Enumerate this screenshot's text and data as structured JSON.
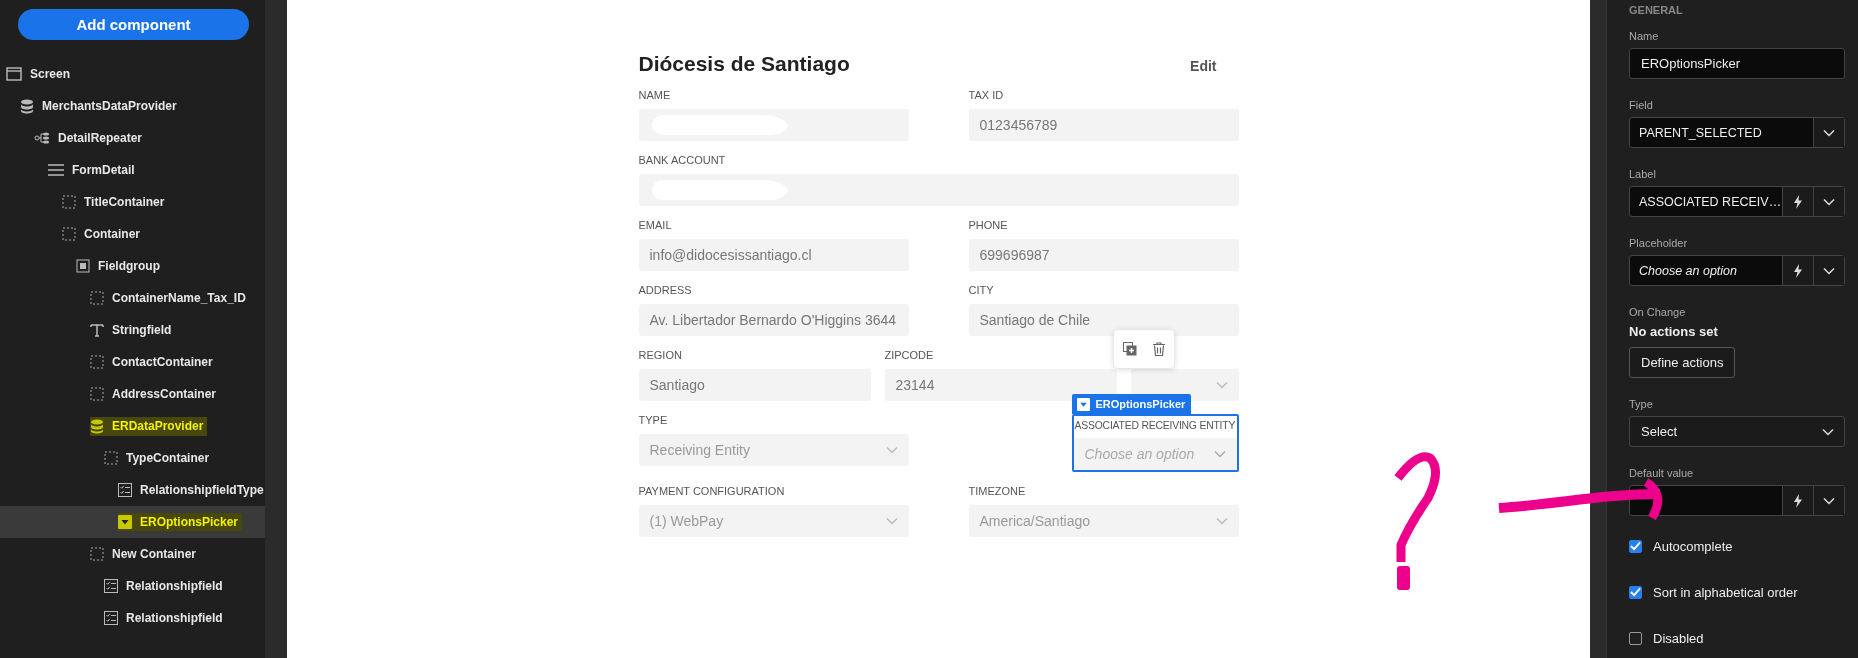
{
  "sidebar": {
    "add_button": "Add component",
    "tree": [
      {
        "label": "Screen",
        "kind": "screen",
        "selected": false,
        "highlighted": false,
        "children": [
          {
            "label": "MerchantsDataProvider",
            "kind": "database",
            "selected": false,
            "highlighted": false,
            "children": [
              {
                "label": "DetailRepeater",
                "kind": "repeater",
                "selected": false,
                "highlighted": false,
                "children": [
                  {
                    "label": "FormDetail",
                    "kind": "list",
                    "selected": false,
                    "highlighted": false,
                    "children": [
                      {
                        "label": "TitleContainer",
                        "kind": "container",
                        "selected": false,
                        "highlighted": false
                      },
                      {
                        "label": "Container",
                        "kind": "container",
                        "selected": false,
                        "highlighted": false,
                        "children": [
                          {
                            "label": "Fieldgroup",
                            "kind": "fieldgroup",
                            "selected": false,
                            "highlighted": false,
                            "children": [
                              {
                                "label": "ContainerName_Tax_ID",
                                "kind": "container",
                                "selected": false,
                                "highlighted": false
                              },
                              {
                                "label": "Stringfield",
                                "kind": "text",
                                "selected": false,
                                "highlighted": false
                              },
                              {
                                "label": "ContactContainer",
                                "kind": "container",
                                "selected": false,
                                "highlighted": false
                              },
                              {
                                "label": "AddressContainer",
                                "kind": "container",
                                "selected": false,
                                "highlighted": false
                              },
                              {
                                "label": "ERDataProvider",
                                "kind": "database",
                                "selected": false,
                                "highlighted": true,
                                "children": [
                                  {
                                    "label": "TypeContainer",
                                    "kind": "container",
                                    "selected": false,
                                    "highlighted": false,
                                    "children": [
                                      {
                                        "label": "RelationshipfieldType",
                                        "kind": "checklist",
                                        "selected": false,
                                        "highlighted": false
                                      },
                                      {
                                        "label": "EROptionsPicker",
                                        "kind": "picker",
                                        "selected": true,
                                        "highlighted": true
                                      }
                                    ]
                                  }
                                ]
                              },
                              {
                                "label": "New Container",
                                "kind": "container",
                                "selected": false,
                                "highlighted": false,
                                "children": [
                                  {
                                    "label": "Relationshipfield",
                                    "kind": "checklist",
                                    "selected": false,
                                    "highlighted": false
                                  },
                                  {
                                    "label": "Relationshipfield",
                                    "kind": "checklist",
                                    "selected": false,
                                    "highlighted": false
                                  }
                                ]
                              }
                            ]
                          }
                        ]
                      }
                    ]
                  }
                ]
              }
            ]
          }
        ]
      }
    ]
  },
  "form": {
    "title": "Diócesis de Santiago",
    "edit": "Edit",
    "rows": [
      [
        {
          "label": "NAME",
          "kind": "redacted"
        },
        {
          "label": "TAX ID",
          "kind": "text",
          "value": "0123456789"
        }
      ],
      [
        {
          "label": "BANK ACCOUNT",
          "kind": "redacted"
        }
      ],
      [
        {
          "label": "EMAIL",
          "kind": "text",
          "value": "info@didocesissantiago.cl"
        },
        {
          "label": "PHONE",
          "kind": "text",
          "value": "699696987"
        }
      ],
      [
        {
          "label": "ADDRESS",
          "kind": "text",
          "value": "Av. Libertador Bernardo O'Higgins 3644"
        },
        {
          "label": "CITY",
          "kind": "text",
          "value": "Santiago de Chile"
        }
      ],
      [
        {
          "label": "REGION",
          "kind": "text",
          "value": "Santiago"
        },
        {
          "label": "ZIPCODE",
          "kind": "text",
          "value": "23144"
        },
        {
          "kind": "select"
        }
      ],
      [
        {
          "label": "TYPE",
          "kind": "select",
          "value": "Receiving Entity"
        },
        {
          "label": "ASSOCIATED RECEIVING ENTITY",
          "kind": "picker",
          "placeholder": "Choose an option",
          "selected": true,
          "tag": "EROptionsPicker"
        }
      ],
      [
        {
          "label": "PAYMENT CONFIGURATION",
          "kind": "select",
          "value": "(1) WebPay"
        },
        {
          "label": "TIMEZONE",
          "kind": "select",
          "value": "America/Santiago"
        }
      ]
    ]
  },
  "panel": {
    "section": "GENERAL",
    "items": [
      {
        "kind": "input",
        "label": "Name",
        "value": "EROptionsPicker"
      },
      {
        "kind": "select",
        "label": "Field",
        "value": "PARENT_SELECTED"
      },
      {
        "kind": "dynamic",
        "label": "Label",
        "value": "ASSOCIATED RECEIV…"
      },
      {
        "kind": "dynamic",
        "label": "Placeholder",
        "placeholder": "Choose an option"
      },
      {
        "kind": "actions",
        "label": "On Change",
        "status": "No actions set",
        "button": "Define actions"
      },
      {
        "kind": "dropdown",
        "label": "Type",
        "value": "Select"
      },
      {
        "kind": "dynamic",
        "label": "Default value"
      }
    ],
    "checkboxes": [
      {
        "label": "Autocomplete",
        "checked": true
      },
      {
        "label": "Sort in alphabetical order",
        "checked": true
      },
      {
        "label": "Disabled",
        "checked": false
      }
    ]
  }
}
